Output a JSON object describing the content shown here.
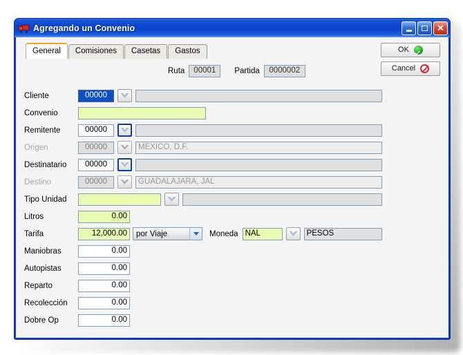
{
  "window": {
    "title": "Agregando un Convenio",
    "icon": "truck-icon",
    "minimize_label": "",
    "maximize_label": "",
    "close_label": "✕",
    "accent_titlebar": "#0b44cf",
    "accent_tab_active": "#f2a81e",
    "field_required_color": "#e9fbb0",
    "field_readonly_color": "#e0e0e0"
  },
  "tabs": [
    {
      "label": "General",
      "active": true
    },
    {
      "label": "Comisiones",
      "active": false
    },
    {
      "label": "Casetas",
      "active": false
    },
    {
      "label": "Gastos",
      "active": false
    }
  ],
  "actions": {
    "ok_label": "OK",
    "cancel_label": "Cancel"
  },
  "header_fields": {
    "ruta_label": "Ruta",
    "ruta_value": "00001",
    "partida_label": "Partida",
    "partida_value": "0000002"
  },
  "form": {
    "cliente": {
      "label": "Cliente",
      "code": "00000",
      "description": ""
    },
    "convenio": {
      "label": "Convenio",
      "value": ""
    },
    "remitente": {
      "label": "Remitente",
      "code": "00000",
      "description": ""
    },
    "origen": {
      "label": "Origen",
      "code": "00000",
      "description": "MEXICO, D.F."
    },
    "destinatario": {
      "label": "Destinatario",
      "code": "00000",
      "description": ""
    },
    "destino": {
      "label": "Destino",
      "code": "00000",
      "description": "GUADALAJARA, JAL"
    },
    "tipo_unidad": {
      "label": "Tipo Unidad",
      "value": "",
      "description": ""
    },
    "litros": {
      "label": "Litros",
      "value": "0.00"
    },
    "tarifa": {
      "label": "Tarifa",
      "value": "12,000.00",
      "unit_selected": "por Viaje",
      "unit_options": [
        "por Viaje"
      ],
      "moneda_label": "Moneda",
      "moneda_code": "NAL",
      "moneda_description": "PESOS"
    },
    "maniobras": {
      "label": "Maniobras",
      "value": "0.00"
    },
    "autopistas": {
      "label": "Autopistas",
      "value": "0.00"
    },
    "reparto": {
      "label": "Reparto",
      "value": "0.00"
    },
    "recoleccion": {
      "label": "Recolección",
      "value": "0.00"
    },
    "dobre_op": {
      "label": "Dobre Op",
      "value": "0.00"
    }
  }
}
